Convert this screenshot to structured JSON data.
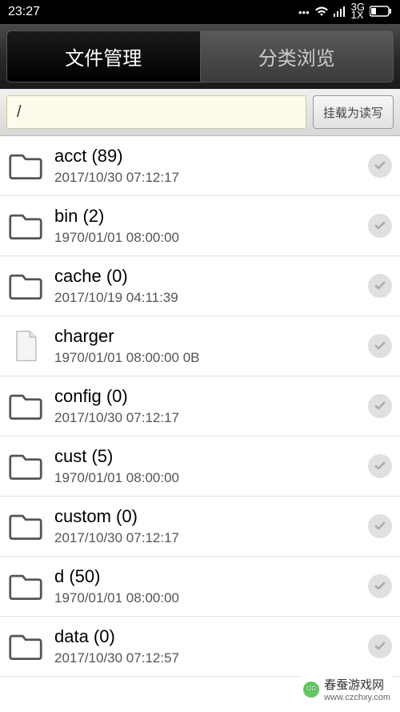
{
  "status_bar": {
    "time": "23:27",
    "network_type": "3G",
    "signal_sub": "1X"
  },
  "tabs": {
    "file_manage": "文件管理",
    "category_browse": "分类浏览"
  },
  "path_bar": {
    "path": "/",
    "mount_btn": "挂载为读写"
  },
  "files": [
    {
      "name": "acct",
      "count": "(89)",
      "date": "2017/10/30 07:12:17",
      "size": "",
      "type": "folder"
    },
    {
      "name": "bin",
      "count": "(2)",
      "date": "1970/01/01 08:00:00",
      "size": "",
      "type": "folder"
    },
    {
      "name": "cache",
      "count": "(0)",
      "date": "2017/10/19 04:11:39",
      "size": "",
      "type": "folder"
    },
    {
      "name": "charger",
      "count": "",
      "date": "1970/01/01 08:00:00",
      "size": "0B",
      "type": "file"
    },
    {
      "name": "config",
      "count": "(0)",
      "date": "2017/10/30 07:12:17",
      "size": "",
      "type": "folder"
    },
    {
      "name": "cust",
      "count": "(5)",
      "date": "1970/01/01 08:00:00",
      "size": "",
      "type": "folder"
    },
    {
      "name": "custom",
      "count": "(0)",
      "date": "2017/10/30 07:12:17",
      "size": "",
      "type": "folder"
    },
    {
      "name": "d",
      "count": "(50)",
      "date": "1970/01/01 08:00:00",
      "size": "",
      "type": "folder"
    },
    {
      "name": "data",
      "count": "(0)",
      "date": "2017/10/30 07:12:57",
      "size": "",
      "type": "folder"
    }
  ],
  "watermark": {
    "title": "春蚕游戏网",
    "url": "www.czchxy.com"
  }
}
